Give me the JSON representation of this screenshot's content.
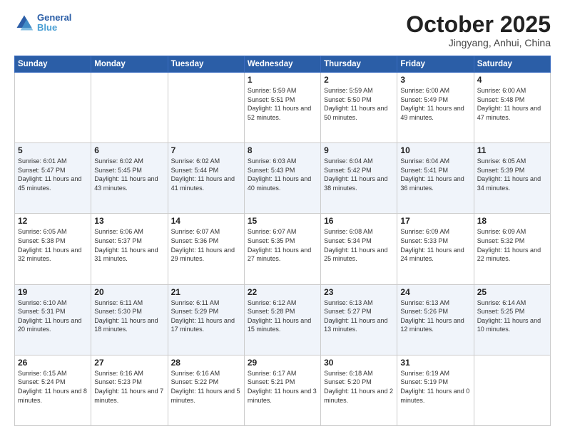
{
  "header": {
    "logo": {
      "line1": "General",
      "line2": "Blue"
    },
    "title": "October 2025",
    "subtitle": "Jingyang, Anhui, China"
  },
  "weekdays": [
    "Sunday",
    "Monday",
    "Tuesday",
    "Wednesday",
    "Thursday",
    "Friday",
    "Saturday"
  ],
  "weeks": [
    {
      "shaded": false,
      "days": [
        {
          "num": "",
          "text": ""
        },
        {
          "num": "",
          "text": ""
        },
        {
          "num": "",
          "text": ""
        },
        {
          "num": "1",
          "text": "Sunrise: 5:59 AM\nSunset: 5:51 PM\nDaylight: 11 hours and 52 minutes."
        },
        {
          "num": "2",
          "text": "Sunrise: 5:59 AM\nSunset: 5:50 PM\nDaylight: 11 hours and 50 minutes."
        },
        {
          "num": "3",
          "text": "Sunrise: 6:00 AM\nSunset: 5:49 PM\nDaylight: 11 hours and 49 minutes."
        },
        {
          "num": "4",
          "text": "Sunrise: 6:00 AM\nSunset: 5:48 PM\nDaylight: 11 hours and 47 minutes."
        }
      ]
    },
    {
      "shaded": true,
      "days": [
        {
          "num": "5",
          "text": "Sunrise: 6:01 AM\nSunset: 5:47 PM\nDaylight: 11 hours and 45 minutes."
        },
        {
          "num": "6",
          "text": "Sunrise: 6:02 AM\nSunset: 5:45 PM\nDaylight: 11 hours and 43 minutes."
        },
        {
          "num": "7",
          "text": "Sunrise: 6:02 AM\nSunset: 5:44 PM\nDaylight: 11 hours and 41 minutes."
        },
        {
          "num": "8",
          "text": "Sunrise: 6:03 AM\nSunset: 5:43 PM\nDaylight: 11 hours and 40 minutes."
        },
        {
          "num": "9",
          "text": "Sunrise: 6:04 AM\nSunset: 5:42 PM\nDaylight: 11 hours and 38 minutes."
        },
        {
          "num": "10",
          "text": "Sunrise: 6:04 AM\nSunset: 5:41 PM\nDaylight: 11 hours and 36 minutes."
        },
        {
          "num": "11",
          "text": "Sunrise: 6:05 AM\nSunset: 5:39 PM\nDaylight: 11 hours and 34 minutes."
        }
      ]
    },
    {
      "shaded": false,
      "days": [
        {
          "num": "12",
          "text": "Sunrise: 6:05 AM\nSunset: 5:38 PM\nDaylight: 11 hours and 32 minutes."
        },
        {
          "num": "13",
          "text": "Sunrise: 6:06 AM\nSunset: 5:37 PM\nDaylight: 11 hours and 31 minutes."
        },
        {
          "num": "14",
          "text": "Sunrise: 6:07 AM\nSunset: 5:36 PM\nDaylight: 11 hours and 29 minutes."
        },
        {
          "num": "15",
          "text": "Sunrise: 6:07 AM\nSunset: 5:35 PM\nDaylight: 11 hours and 27 minutes."
        },
        {
          "num": "16",
          "text": "Sunrise: 6:08 AM\nSunset: 5:34 PM\nDaylight: 11 hours and 25 minutes."
        },
        {
          "num": "17",
          "text": "Sunrise: 6:09 AM\nSunset: 5:33 PM\nDaylight: 11 hours and 24 minutes."
        },
        {
          "num": "18",
          "text": "Sunrise: 6:09 AM\nSunset: 5:32 PM\nDaylight: 11 hours and 22 minutes."
        }
      ]
    },
    {
      "shaded": true,
      "days": [
        {
          "num": "19",
          "text": "Sunrise: 6:10 AM\nSunset: 5:31 PM\nDaylight: 11 hours and 20 minutes."
        },
        {
          "num": "20",
          "text": "Sunrise: 6:11 AM\nSunset: 5:30 PM\nDaylight: 11 hours and 18 minutes."
        },
        {
          "num": "21",
          "text": "Sunrise: 6:11 AM\nSunset: 5:29 PM\nDaylight: 11 hours and 17 minutes."
        },
        {
          "num": "22",
          "text": "Sunrise: 6:12 AM\nSunset: 5:28 PM\nDaylight: 11 hours and 15 minutes."
        },
        {
          "num": "23",
          "text": "Sunrise: 6:13 AM\nSunset: 5:27 PM\nDaylight: 11 hours and 13 minutes."
        },
        {
          "num": "24",
          "text": "Sunrise: 6:13 AM\nSunset: 5:26 PM\nDaylight: 11 hours and 12 minutes."
        },
        {
          "num": "25",
          "text": "Sunrise: 6:14 AM\nSunset: 5:25 PM\nDaylight: 11 hours and 10 minutes."
        }
      ]
    },
    {
      "shaded": false,
      "days": [
        {
          "num": "26",
          "text": "Sunrise: 6:15 AM\nSunset: 5:24 PM\nDaylight: 11 hours and 8 minutes."
        },
        {
          "num": "27",
          "text": "Sunrise: 6:16 AM\nSunset: 5:23 PM\nDaylight: 11 hours and 7 minutes."
        },
        {
          "num": "28",
          "text": "Sunrise: 6:16 AM\nSunset: 5:22 PM\nDaylight: 11 hours and 5 minutes."
        },
        {
          "num": "29",
          "text": "Sunrise: 6:17 AM\nSunset: 5:21 PM\nDaylight: 11 hours and 3 minutes."
        },
        {
          "num": "30",
          "text": "Sunrise: 6:18 AM\nSunset: 5:20 PM\nDaylight: 11 hours and 2 minutes."
        },
        {
          "num": "31",
          "text": "Sunrise: 6:19 AM\nSunset: 5:19 PM\nDaylight: 11 hours and 0 minutes."
        },
        {
          "num": "",
          "text": ""
        }
      ]
    }
  ]
}
